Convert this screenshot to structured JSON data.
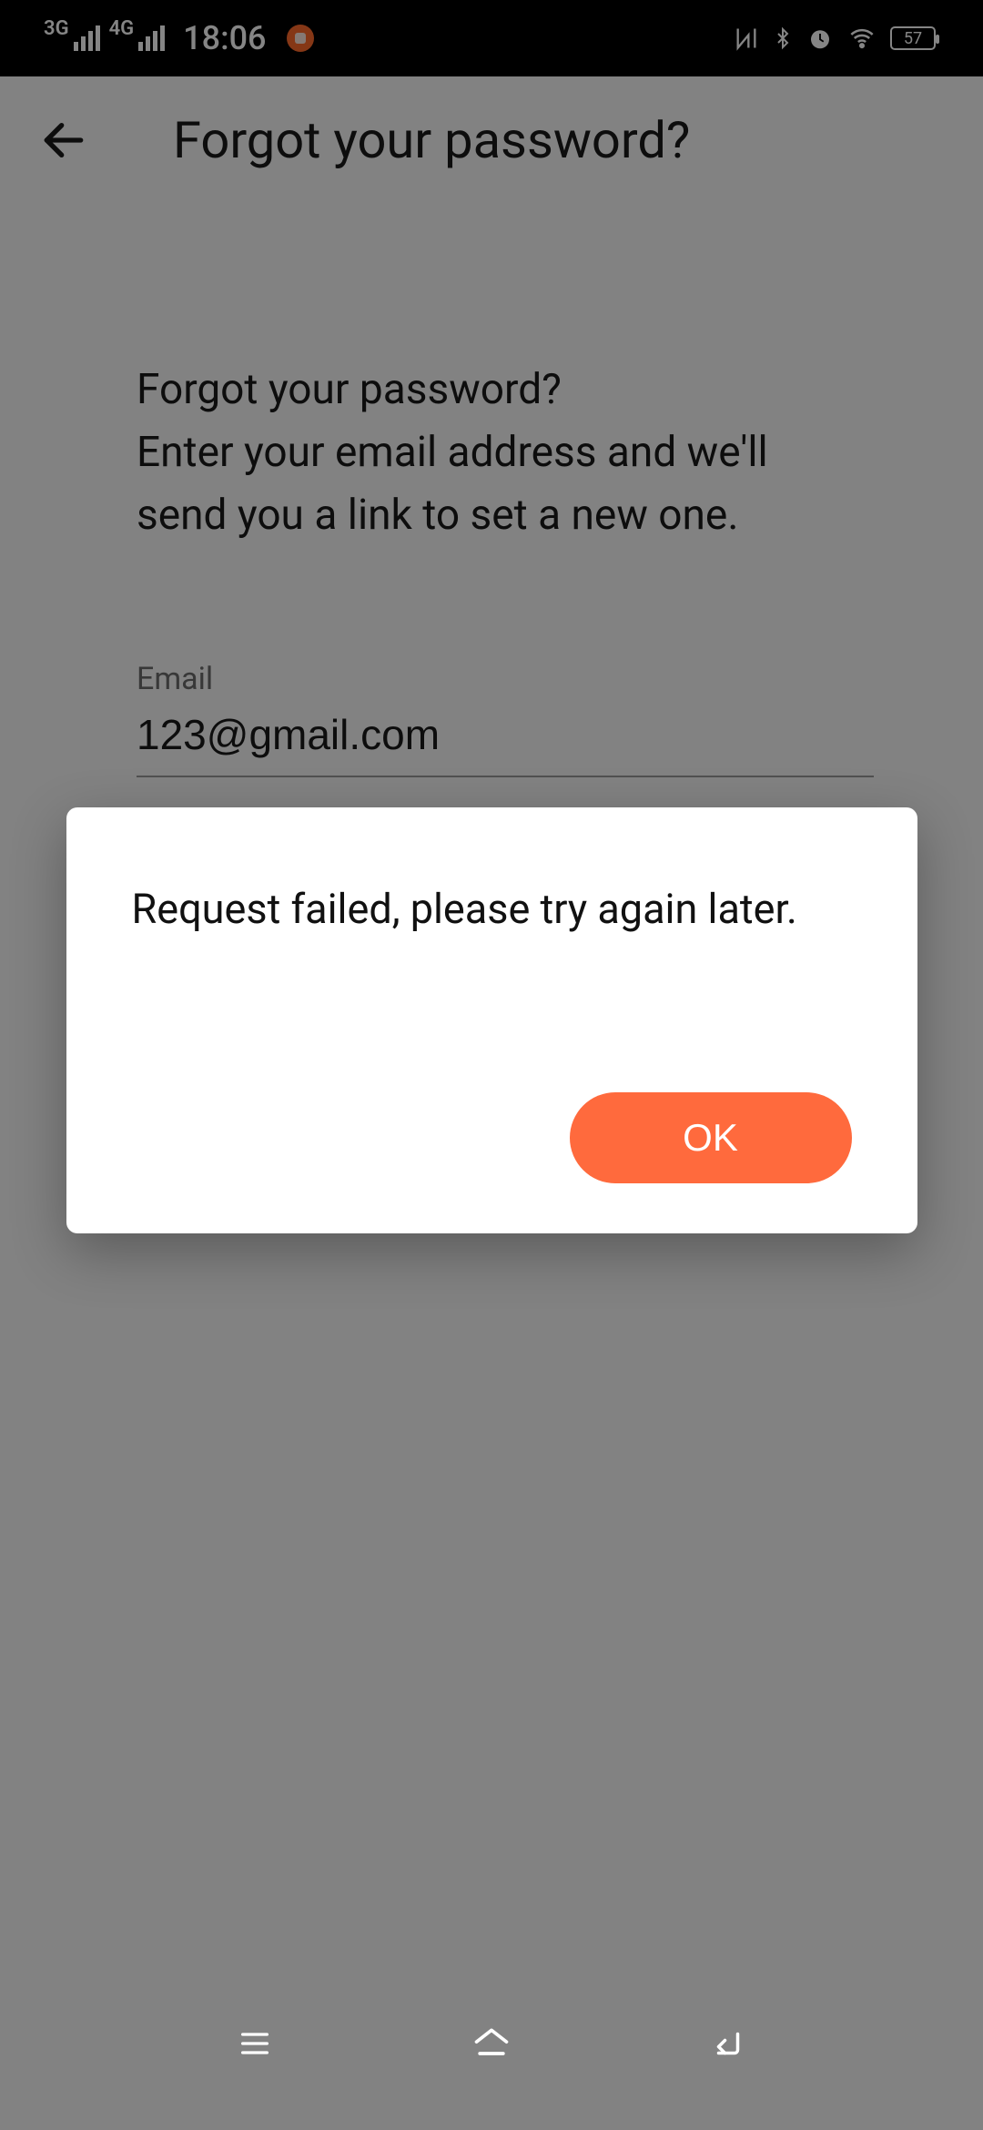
{
  "status": {
    "signal1_label": "3G",
    "signal2_label": "4G",
    "time": "18:06",
    "battery_text": "57"
  },
  "header": {
    "title": "Forgot your password?"
  },
  "content": {
    "description": "Forgot your password?\nEnter your email address and we'll send you a link to set a new one.",
    "desc_line1": "Forgot your password?",
    "desc_line2": "Enter your email address and we'll",
    "desc_line3": "send you a link to set a new one.",
    "email_label": "Email",
    "email_value": "123@gmail.com"
  },
  "dialog": {
    "message": "Request failed, please try again later.",
    "ok_label": "OK"
  },
  "colors": {
    "accent": "#ff6a3d"
  }
}
